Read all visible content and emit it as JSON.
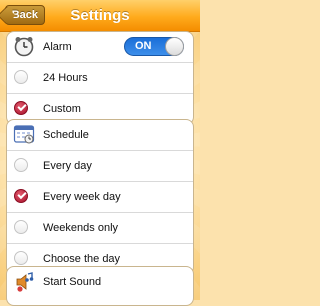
{
  "navbar": {
    "title": "Settings",
    "back_label": "Back"
  },
  "alarm_group": {
    "alarm_label": "Alarm",
    "alarm_toggle": "ON",
    "options": [
      {
        "label": "24 Hours",
        "checked": false
      },
      {
        "label": "Custom",
        "checked": true
      }
    ]
  },
  "schedule_group": {
    "header_label": "Schedule",
    "options": [
      {
        "label": "Every day",
        "checked": false
      },
      {
        "label": "Every week day",
        "checked": true
      },
      {
        "label": "Weekends only",
        "checked": false
      },
      {
        "label": "Choose the day",
        "checked": false
      }
    ]
  },
  "sound_group": {
    "header_label": "Start Sound"
  },
  "colors": {
    "accent": "#f49a10",
    "toggle_on": "#2a7de0",
    "radio_checked": "#b81c36"
  }
}
